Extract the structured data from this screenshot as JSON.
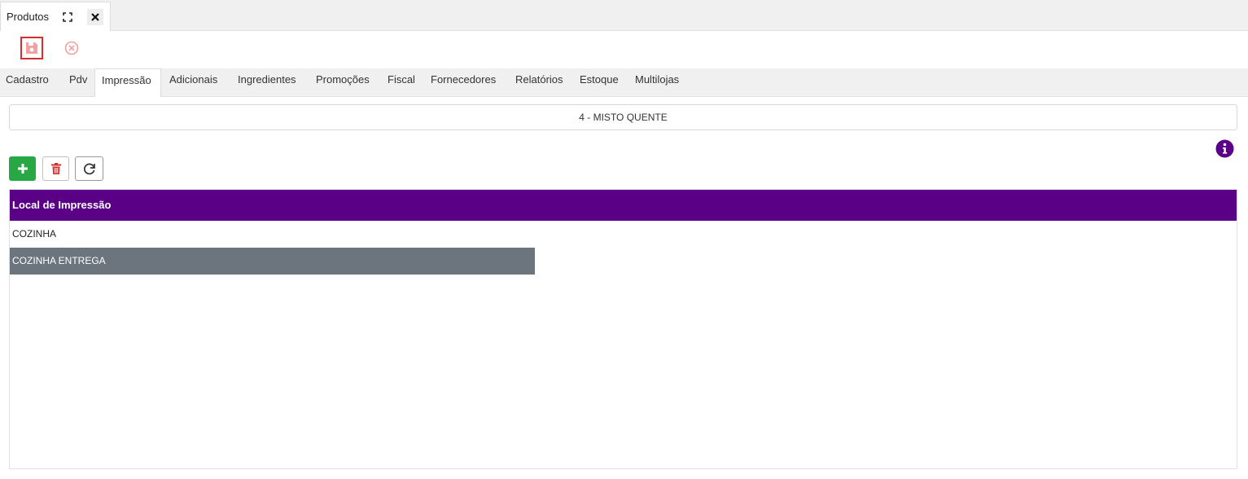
{
  "window_tab": {
    "title": "Produtos",
    "maximize_icon": "maximize-icon",
    "close_icon": "close-icon"
  },
  "toolbar": {
    "save_icon": "floppy-disk-icon",
    "cancel_icon": "cancel-circle-icon"
  },
  "tabs": [
    {
      "label": "Cadastro",
      "active": false
    },
    {
      "label": "Pdv",
      "active": false
    },
    {
      "label": "Impressão",
      "active": true
    },
    {
      "label": "Adicionais",
      "active": false
    },
    {
      "label": "Ingredientes",
      "active": false
    },
    {
      "label": "Promoções",
      "active": false
    },
    {
      "label": "Fiscal",
      "active": false
    },
    {
      "label": "Fornecedores",
      "active": false
    },
    {
      "label": "Relatórios",
      "active": false
    },
    {
      "label": "Estoque",
      "active": false
    },
    {
      "label": "Multilojas",
      "active": false
    }
  ],
  "product": {
    "title": "4 - MISTO QUENTE"
  },
  "grid_toolbar": {
    "add_icon": "plus-icon",
    "delete_icon": "trash-icon",
    "refresh_icon": "refresh-icon",
    "info_icon": "info-icon"
  },
  "grid": {
    "header": "Local de Impressão",
    "rows": [
      {
        "label": "COZINHA",
        "selected": false
      },
      {
        "label": "COZINHA ENTREGA",
        "selected": true
      }
    ]
  },
  "colors": {
    "accent": "#5a0087",
    "add_button": "#27a844",
    "selected_row": "#6c757d",
    "danger": "#d32f2f"
  }
}
